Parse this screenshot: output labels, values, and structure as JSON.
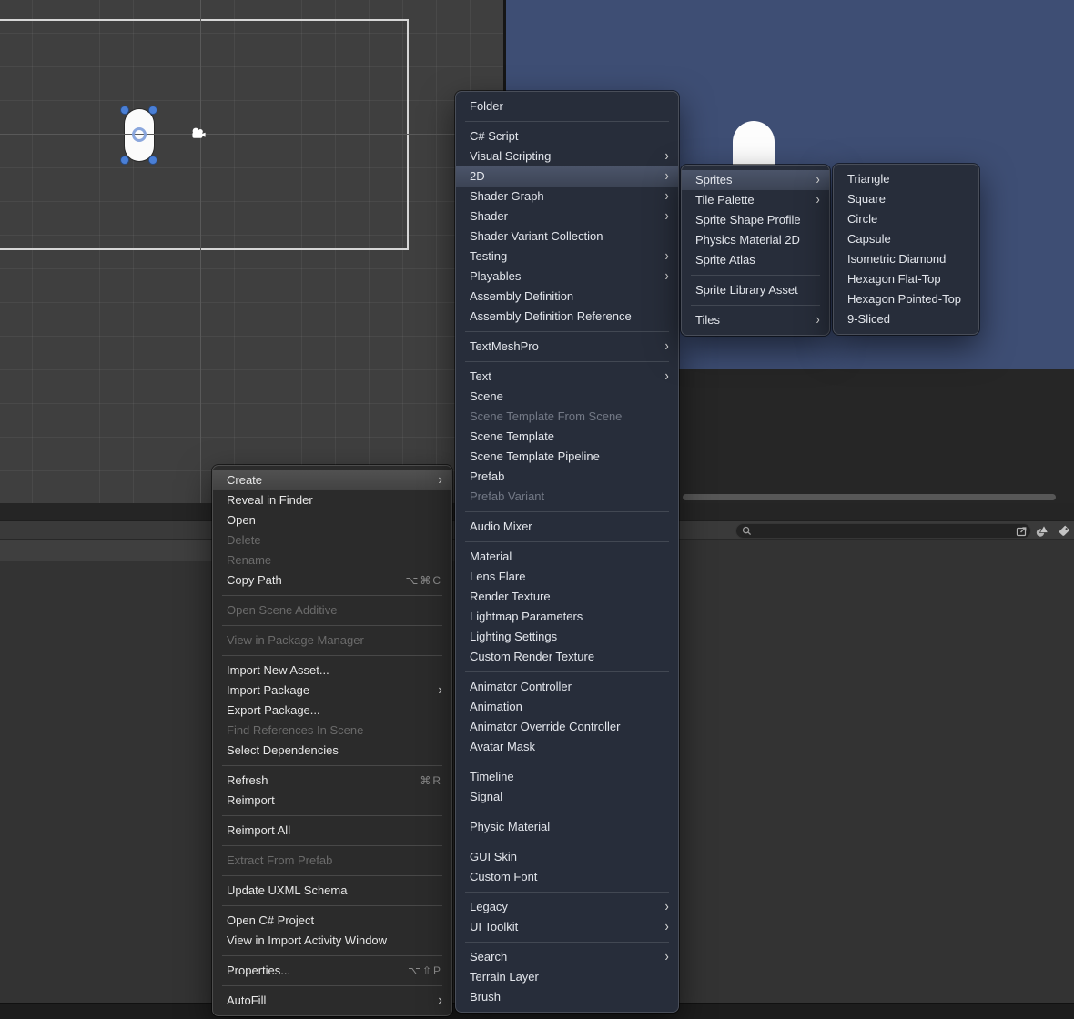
{
  "colors": {
    "scene_view_background": "#3f3f3f",
    "game_view_background": "#3e4e74",
    "selection_handle_blue": "#4a7fd6",
    "menu_gray_background": "#2b2b2b",
    "menu_blue_background": "#272d3a",
    "menu_highlight_gray": "#4a4a4a",
    "menu_highlight_blue": "#49536a"
  },
  "scene_view": {
    "sprites": [
      "capsule"
    ],
    "gizmos": [
      "camera"
    ]
  },
  "game_view": {
    "sprites": [
      "capsule"
    ]
  },
  "project_toolbar": {
    "search": {
      "value": "",
      "placeholder": ""
    },
    "icons": [
      "open-in-window",
      "filter-by-type",
      "filter-by-label"
    ]
  },
  "menus": {
    "context_menu": {
      "items": [
        {
          "label": "Create",
          "arrow": true,
          "state": "highlighted"
        },
        {
          "label": "Reveal in Finder"
        },
        {
          "label": "Open"
        },
        {
          "label": "Delete",
          "state": "disabled"
        },
        {
          "label": "Rename",
          "state": "disabled"
        },
        {
          "label": "Copy Path",
          "shortcut": "⌥⌘C"
        },
        {
          "type": "separator"
        },
        {
          "label": "Open Scene Additive",
          "state": "disabled"
        },
        {
          "type": "separator"
        },
        {
          "label": "View in Package Manager",
          "state": "disabled"
        },
        {
          "type": "separator"
        },
        {
          "label": "Import New Asset..."
        },
        {
          "label": "Import Package",
          "arrow": true
        },
        {
          "label": "Export Package..."
        },
        {
          "label": "Find References In Scene",
          "state": "disabled"
        },
        {
          "label": "Select Dependencies"
        },
        {
          "type": "separator"
        },
        {
          "label": "Refresh",
          "shortcut": "⌘R"
        },
        {
          "label": "Reimport"
        },
        {
          "type": "separator"
        },
        {
          "label": "Reimport All"
        },
        {
          "type": "separator"
        },
        {
          "label": "Extract From Prefab",
          "state": "disabled"
        },
        {
          "type": "separator"
        },
        {
          "label": "Update UXML Schema"
        },
        {
          "type": "separator"
        },
        {
          "label": "Open C# Project"
        },
        {
          "label": "View in Import Activity Window"
        },
        {
          "type": "separator"
        },
        {
          "label": "Properties...",
          "shortcut": "⌥⇧P"
        },
        {
          "type": "separator"
        },
        {
          "label": "AutoFill",
          "arrow": true
        }
      ]
    },
    "create_submenu": {
      "items": [
        {
          "label": "Folder"
        },
        {
          "type": "separator"
        },
        {
          "label": "C# Script"
        },
        {
          "label": "Visual Scripting",
          "arrow": true
        },
        {
          "label": "2D",
          "arrow": true,
          "state": "highlighted"
        },
        {
          "label": "Shader Graph",
          "arrow": true
        },
        {
          "label": "Shader",
          "arrow": true
        },
        {
          "label": "Shader Variant Collection"
        },
        {
          "label": "Testing",
          "arrow": true
        },
        {
          "label": "Playables",
          "arrow": true
        },
        {
          "label": "Assembly Definition"
        },
        {
          "label": "Assembly Definition Reference"
        },
        {
          "type": "separator"
        },
        {
          "label": "TextMeshPro",
          "arrow": true
        },
        {
          "type": "separator"
        },
        {
          "label": "Text",
          "arrow": true
        },
        {
          "label": "Scene"
        },
        {
          "label": "Scene Template From Scene",
          "state": "disabled"
        },
        {
          "label": "Scene Template"
        },
        {
          "label": "Scene Template Pipeline"
        },
        {
          "label": "Prefab"
        },
        {
          "label": "Prefab Variant",
          "state": "disabled"
        },
        {
          "type": "separator"
        },
        {
          "label": "Audio Mixer"
        },
        {
          "type": "separator"
        },
        {
          "label": "Material"
        },
        {
          "label": "Lens Flare"
        },
        {
          "label": "Render Texture"
        },
        {
          "label": "Lightmap Parameters"
        },
        {
          "label": "Lighting Settings"
        },
        {
          "label": "Custom Render Texture"
        },
        {
          "type": "separator"
        },
        {
          "label": "Animator Controller"
        },
        {
          "label": "Animation"
        },
        {
          "label": "Animator Override Controller"
        },
        {
          "label": "Avatar Mask"
        },
        {
          "type": "separator"
        },
        {
          "label": "Timeline"
        },
        {
          "label": "Signal"
        },
        {
          "type": "separator"
        },
        {
          "label": "Physic Material"
        },
        {
          "type": "separator"
        },
        {
          "label": "GUI Skin"
        },
        {
          "label": "Custom Font"
        },
        {
          "type": "separator"
        },
        {
          "label": "Legacy",
          "arrow": true
        },
        {
          "label": "UI Toolkit",
          "arrow": true
        },
        {
          "type": "separator"
        },
        {
          "label": "Search",
          "arrow": true
        },
        {
          "label": "Terrain Layer"
        },
        {
          "label": "Brush"
        }
      ]
    },
    "menu_2d": {
      "items": [
        {
          "label": "Sprites",
          "arrow": true,
          "state": "highlighted"
        },
        {
          "label": "Tile Palette",
          "arrow": true
        },
        {
          "label": "Sprite Shape Profile"
        },
        {
          "label": "Physics Material 2D"
        },
        {
          "label": "Sprite Atlas"
        },
        {
          "type": "separator"
        },
        {
          "label": "Sprite Library Asset"
        },
        {
          "type": "separator"
        },
        {
          "label": "Tiles",
          "arrow": true
        }
      ]
    },
    "menu_sprites": {
      "items": [
        {
          "label": "Triangle"
        },
        {
          "label": "Square"
        },
        {
          "label": "Circle"
        },
        {
          "label": "Capsule"
        },
        {
          "label": "Isometric Diamond"
        },
        {
          "label": "Hexagon Flat-Top"
        },
        {
          "label": "Hexagon Pointed-Top"
        },
        {
          "label": "9-Sliced"
        }
      ]
    }
  }
}
